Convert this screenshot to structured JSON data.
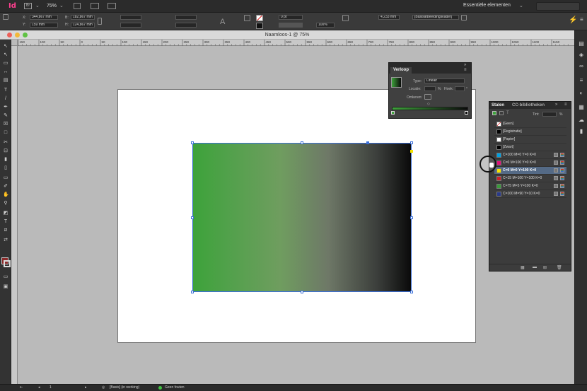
{
  "app": {
    "logo": "Id",
    "bridge_label": "Br",
    "zoom": "75%",
    "workspace": "Essentiële elementen",
    "workspace_chevron": "⌄"
  },
  "control_bar": {
    "x": "344,867 mm",
    "y": "159 mm",
    "w": "182,867 mm",
    "h": "124,867 mm",
    "stroke_weight": "0 pt",
    "opacity": "100%",
    "measure": "4,233 mm",
    "frame_style": "[Basisafbeeldingskader]"
  },
  "document": {
    "title": "Naamloos-1 @ 75%"
  },
  "ruler_ticks": [
    "150",
    "100",
    "50",
    "0",
    "50",
    "100",
    "150",
    "200",
    "250",
    "300",
    "350",
    "400",
    "450",
    "500",
    "550",
    "600",
    "650",
    "700",
    "750",
    "800",
    "850",
    "900",
    "950",
    "1000",
    "1050",
    "1100",
    "1150",
    "1200"
  ],
  "gradient_panel": {
    "title": "Verloop",
    "type_label": "Type:",
    "type_value": "Lineair",
    "location_label": "Locatie:",
    "location_unit": "%",
    "angle_label": "Hoek:",
    "angle_unit": "°",
    "reverse_label": "Omkeren:"
  },
  "swatches_panel": {
    "tab_swatches": "Stalen",
    "tab_cc": "CC-bibliotheken",
    "tint_label": "Tint:",
    "tint_unit": "%",
    "items": [
      {
        "name": "[Geen]",
        "color": "#ffffff",
        "selected": false
      },
      {
        "name": "[Registratie]",
        "color": "#000000",
        "selected": false
      },
      {
        "name": "[Papier]",
        "color": "#ffffff",
        "selected": false
      },
      {
        "name": "[Zwart]",
        "color": "#000000",
        "selected": false
      },
      {
        "name": "C=100 M=0 Y=0 K=0",
        "color": "#00a0e0",
        "selected": false
      },
      {
        "name": "C=0 M=100 Y=0 K=0",
        "color": "#e0107a",
        "selected": false
      },
      {
        "name": "C=0 M=0 Y=100 K=0",
        "color": "#f5e400",
        "selected": true
      },
      {
        "name": "C=15 M=100 Y=100 K=0",
        "color": "#c8202a",
        "selected": false
      },
      {
        "name": "C=75 M=5 Y=100 K=0",
        "color": "#3a9a3a",
        "selected": false
      },
      {
        "name": "C=100 M=90 Y=10 K=0",
        "color": "#2a3a8a",
        "selected": false
      }
    ]
  },
  "status_bar": {
    "page": "1",
    "profile": "[Basis] (in werking)",
    "preflight": "Geen fouten"
  },
  "colors": {
    "gradient_start": "#3da23a",
    "gradient_end": "#0a0a0a",
    "fill_swatch": "#8b2a2a",
    "selection": "#3b6fd8"
  }
}
